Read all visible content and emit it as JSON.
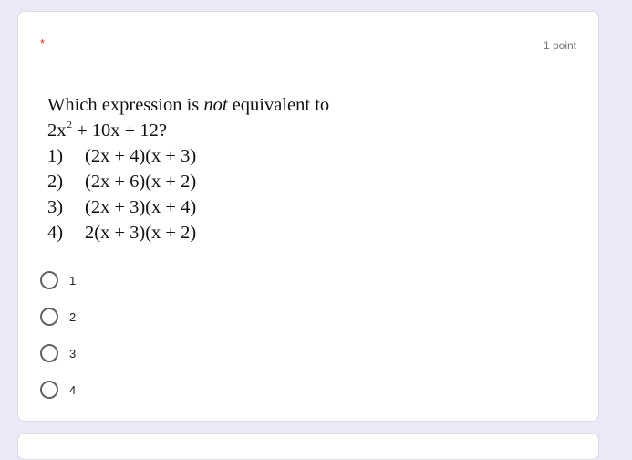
{
  "card": {
    "required_mark": "*",
    "points": "1 point"
  },
  "question": {
    "line1_pre": "Which expression is ",
    "line1_em": "not",
    "line1_post": " equivalent to",
    "line2_pre": "2x",
    "line2_sup": "2",
    "line2_post": " + 10x + 12?",
    "choices": [
      {
        "num": "1)",
        "expr": "(2x + 4)(x + 3)"
      },
      {
        "num": "2)",
        "expr": "(2x + 6)(x + 2)"
      },
      {
        "num": "3)",
        "expr": "(2x + 3)(x + 4)"
      },
      {
        "num": "4)",
        "expr": "2(x + 3)(x + 2)"
      }
    ]
  },
  "options": [
    {
      "label": "1",
      "selected": false
    },
    {
      "label": "2",
      "selected": false
    },
    {
      "label": "3",
      "selected": false
    },
    {
      "label": "4",
      "selected": false
    }
  ]
}
